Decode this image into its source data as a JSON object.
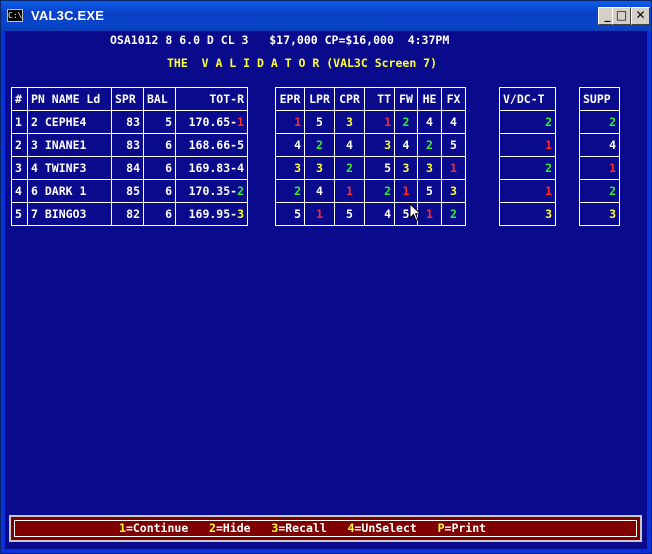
{
  "window": {
    "title": "VAL3C.EXE",
    "icon_text": "C:\\"
  },
  "header": {
    "status_line": "OSA1012 8 6.0 D CL 3   $17,000 CP=$16,000  4:37PM",
    "screen_title": "THE  V A L I D A T O R (VAL3C Screen 7)"
  },
  "main_table": {
    "headers": [
      "#",
      "PN",
      "NAME Ld",
      "SPR",
      "BAL",
      "TOT-R"
    ],
    "rows": [
      {
        "num": "1",
        "pn": "2",
        "name": "CEPHE4",
        "spr": "83",
        "bal": "5",
        "tot": "170.65-",
        "tot_rank": "1",
        "tot_color": "red"
      },
      {
        "num": "2",
        "pn": "3",
        "name": "INANE1",
        "spr": "83",
        "bal": "6",
        "tot": "168.66-",
        "tot_rank": "5",
        "tot_color": "white"
      },
      {
        "num": "3",
        "pn": "4",
        "name": "TWINF3",
        "spr": "84",
        "bal": "6",
        "tot": "169.83-",
        "tot_rank": "4",
        "tot_color": "white"
      },
      {
        "num": "4",
        "pn": "6",
        "name": "DARK 1",
        "spr": "85",
        "bal": "6",
        "tot": "170.35-",
        "tot_rank": "2",
        "tot_color": "green"
      },
      {
        "num": "5",
        "pn": "7",
        "name": "BINGO3",
        "spr": "82",
        "bal": "6",
        "tot": "169.95-",
        "tot_rank": "3",
        "tot_color": "yellow"
      }
    ]
  },
  "rank_table": {
    "headers": [
      "EPR",
      "LPR",
      "CPR",
      "TT",
      "FW",
      "HE",
      "FX"
    ],
    "rows": [
      [
        "1",
        "5",
        "3",
        "1",
        "2",
        "4",
        "4"
      ],
      [
        "4",
        "2",
        "4",
        "3",
        "4",
        "2",
        "5"
      ],
      [
        "3",
        "3",
        "2",
        "5",
        "3",
        "3",
        "1"
      ],
      [
        "2",
        "4",
        "1",
        "2",
        "1",
        "5",
        "3"
      ],
      [
        "5",
        "1",
        "5",
        "4",
        "5",
        "1",
        "2"
      ]
    ]
  },
  "vdc_table": {
    "header": "V/DC-T",
    "values": [
      "2",
      "1",
      "2",
      "1",
      "3"
    ]
  },
  "supp_table": {
    "header": "SUPP",
    "values": [
      "2",
      "4",
      "1",
      "2",
      "3"
    ]
  },
  "footer": {
    "items": [
      {
        "key": "1",
        "label": "=Continue"
      },
      {
        "key": "2",
        "label": "=Hide"
      },
      {
        "key": "3",
        "label": "=Recall"
      },
      {
        "key": "4",
        "label": "=UnSelect"
      },
      {
        "key": "P",
        "label": "=Print"
      }
    ]
  },
  "colors": {
    "rank_1": "#ff2a2a",
    "rank_2": "#33ee33",
    "rank_3": "#ffff33",
    "other": "#ffffff",
    "background": "#0a0a8c",
    "footer_bg": "#800000",
    "title_text": "#ffff33"
  }
}
